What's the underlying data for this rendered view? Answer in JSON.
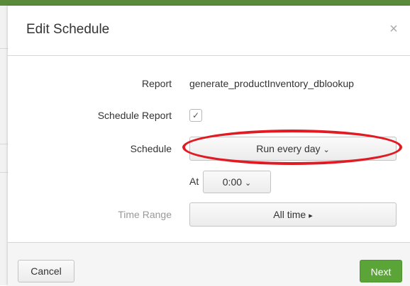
{
  "dialog": {
    "title": "Edit Schedule",
    "close_glyph": "×"
  },
  "form": {
    "report_label": "Report",
    "report_value": "generate_productInventory_dblookup",
    "schedule_report_label": "Schedule Report",
    "schedule_report_checked": true,
    "checkbox_glyph": "✓",
    "schedule_label": "Schedule",
    "schedule_value": "Run every day",
    "at_label": "At",
    "at_value": "0:00",
    "time_range_label": "Time Range",
    "time_range_value": "All time"
  },
  "icons": {
    "chevron_down": "⌄",
    "caret_right": "▸"
  },
  "footer": {
    "cancel_label": "Cancel",
    "next_label": "Next"
  },
  "colors": {
    "primary_button": "#5ba437",
    "annotation": "#e01b24",
    "app_header": "#5a8a3a"
  }
}
